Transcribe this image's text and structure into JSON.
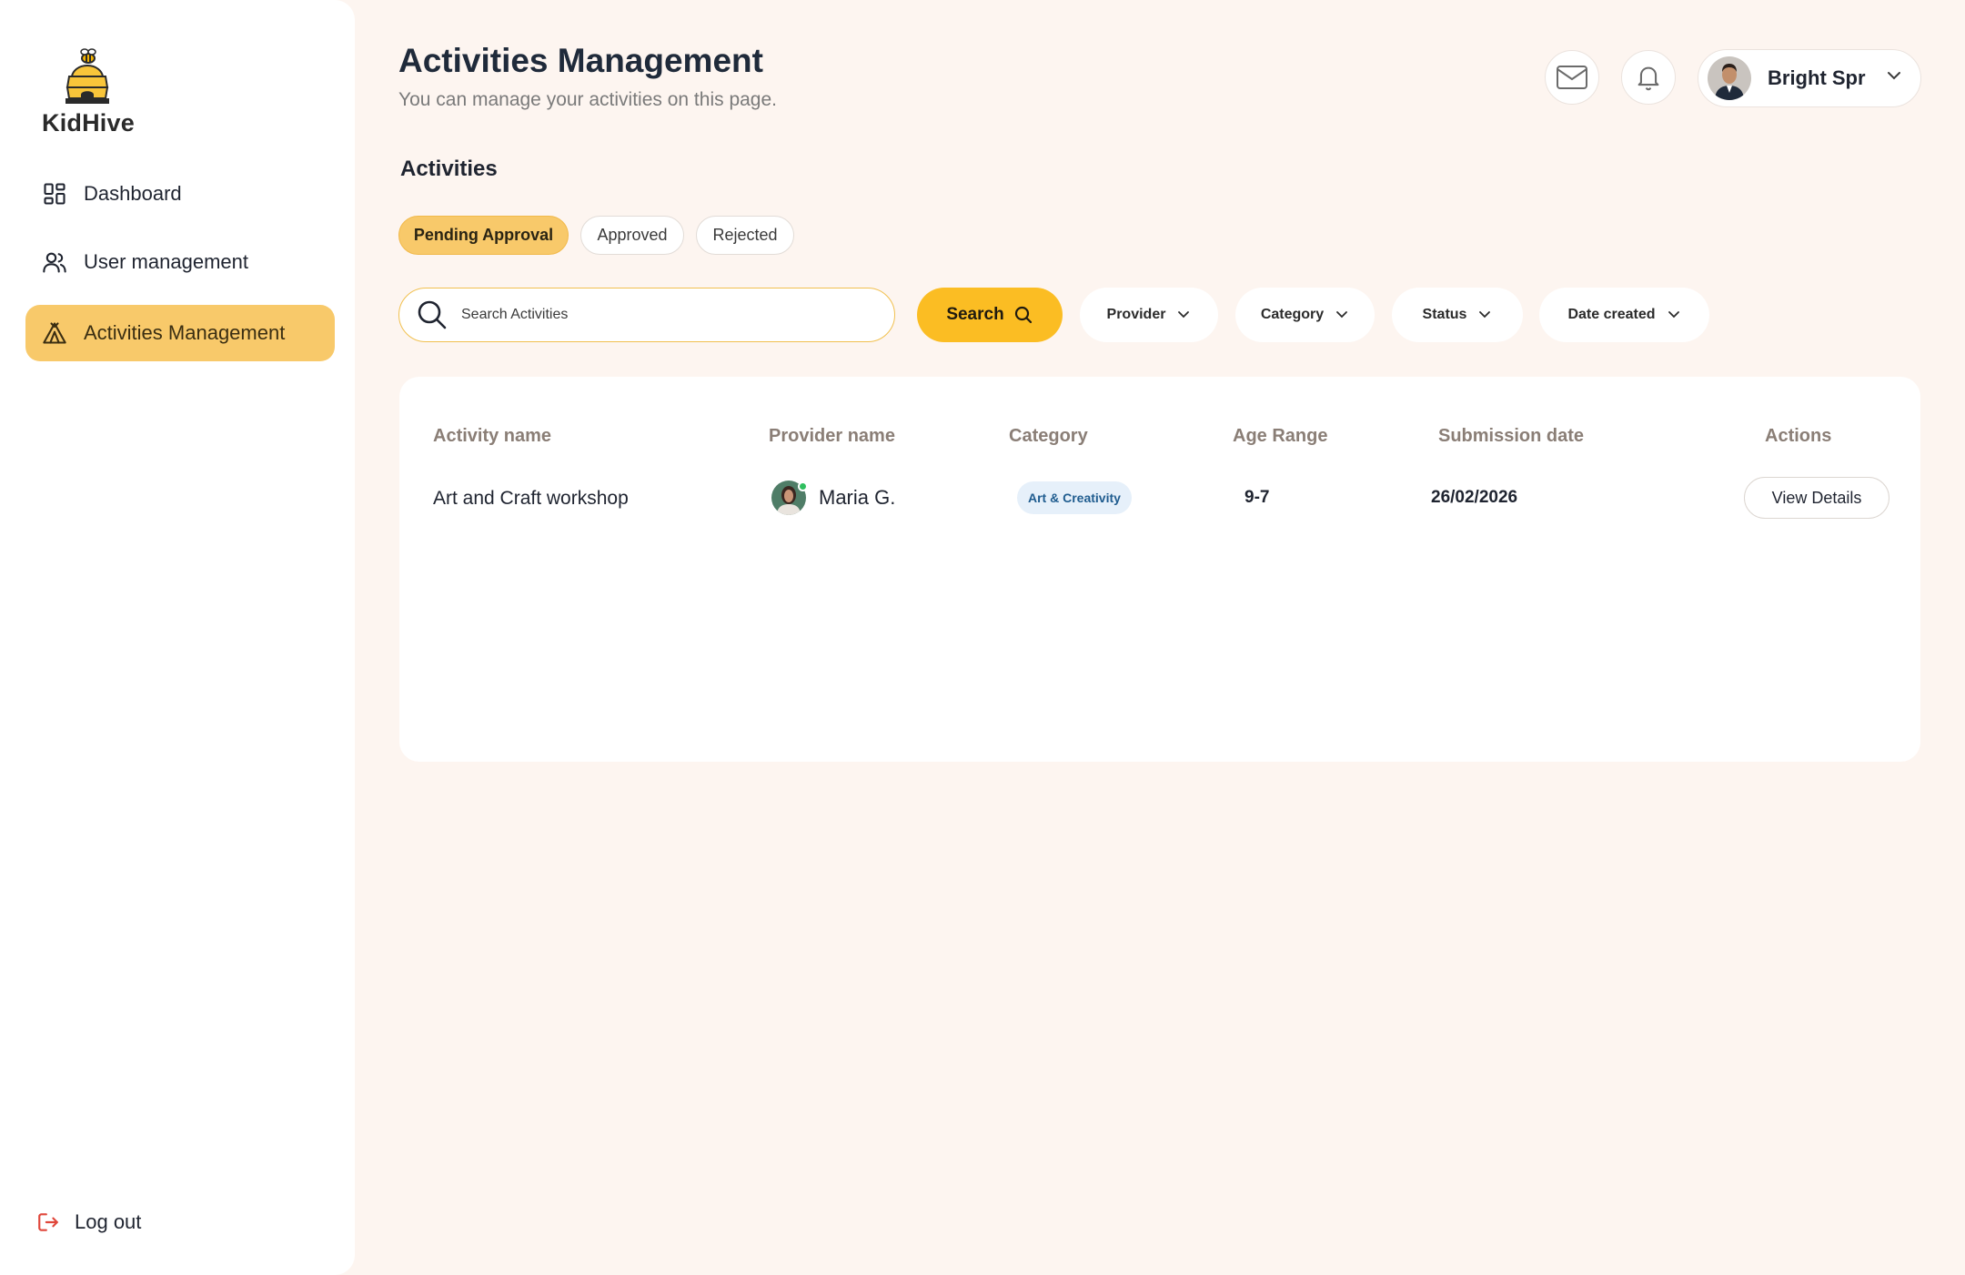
{
  "brand": {
    "name": "KidHive",
    "accent": "#fbbd23",
    "active_nav_bg": "#f8c96a"
  },
  "sidebar": {
    "items": [
      {
        "label": "Dashboard",
        "icon": "dashboard-grid-icon",
        "active": false
      },
      {
        "label": "User management",
        "icon": "users-icon",
        "active": false
      },
      {
        "label": "Activities Management",
        "icon": "tent-icon",
        "active": true
      }
    ],
    "logout_label": "Log out"
  },
  "header": {
    "title": "Activities Management",
    "subtitle": "You can manage your activities on this page.",
    "user_name": "Bright Spr"
  },
  "section": {
    "title": "Activities"
  },
  "tabs": [
    {
      "label": "Pending Approval",
      "active": true
    },
    {
      "label": "Approved",
      "active": false
    },
    {
      "label": "Rejected",
      "active": false
    }
  ],
  "search": {
    "placeholder": "Search Activities",
    "value": "",
    "button_label": "Search"
  },
  "filters": [
    {
      "label": "Provider"
    },
    {
      "label": "Category"
    },
    {
      "label": "Status"
    },
    {
      "label": "Date created"
    }
  ],
  "table": {
    "columns": [
      "Activity name",
      "Provider name",
      "Category",
      "Age Range",
      "Submission date",
      "Actions"
    ],
    "rows": [
      {
        "activity_name": "Art and Craft workshop",
        "provider_name": "Maria G.",
        "category": "Art & Creativity",
        "age_range": "9-7",
        "submission_date": "26/02/2026",
        "action_label": "View Details"
      }
    ]
  }
}
